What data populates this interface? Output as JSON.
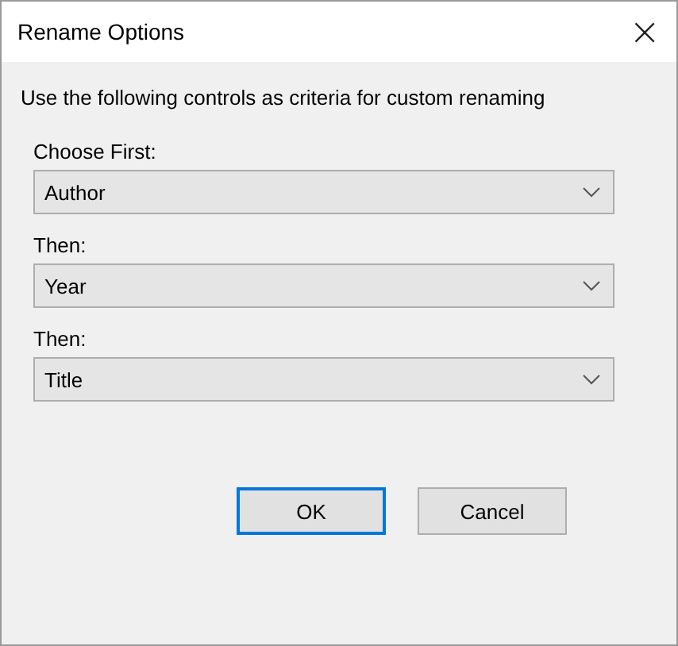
{
  "window": {
    "title": "Rename Options",
    "close": "×"
  },
  "description": "Use the following controls as criteria for custom renaming",
  "fields": [
    {
      "label": "Choose First:",
      "value": "Author"
    },
    {
      "label": "Then:",
      "value": "Year"
    },
    {
      "label": "Then:",
      "value": "Title"
    }
  ],
  "buttons": [
    {
      "label": "OK",
      "default": true
    },
    {
      "label": "Cancel",
      "default": false
    }
  ]
}
